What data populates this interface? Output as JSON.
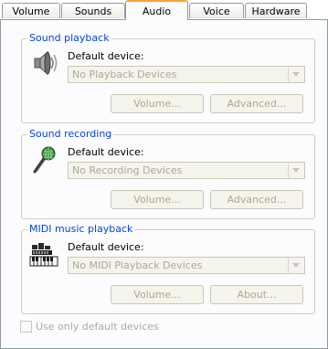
{
  "tabs": [
    {
      "label": "Volume"
    },
    {
      "label": "Sounds"
    },
    {
      "label": "Audio",
      "active": true
    },
    {
      "label": "Voice"
    },
    {
      "label": "Hardware"
    }
  ],
  "playback": {
    "title": "Sound playback",
    "icon": "speaker-icon",
    "label": "Default device:",
    "device": "No Playback Devices",
    "volume_button": "Volume...",
    "advanced_button": "Advanced..."
  },
  "recording": {
    "title": "Sound recording",
    "icon": "microphone-icon",
    "label": "Default device:",
    "device": "No Recording Devices",
    "volume_button": "Volume...",
    "advanced_button": "Advanced..."
  },
  "midi": {
    "title": "MIDI music playback",
    "icon": "midi-keyboard-icon",
    "label": "Default device:",
    "device": "No MIDI Playback Devices",
    "volume_button": "Volume...",
    "about_button": "About..."
  },
  "default_only": {
    "label": "Use only default devices",
    "checked": false
  },
  "colors": {
    "group_title": "#0046d5",
    "tab_highlight": "#f3a637",
    "disabled_text": "#aca899"
  }
}
